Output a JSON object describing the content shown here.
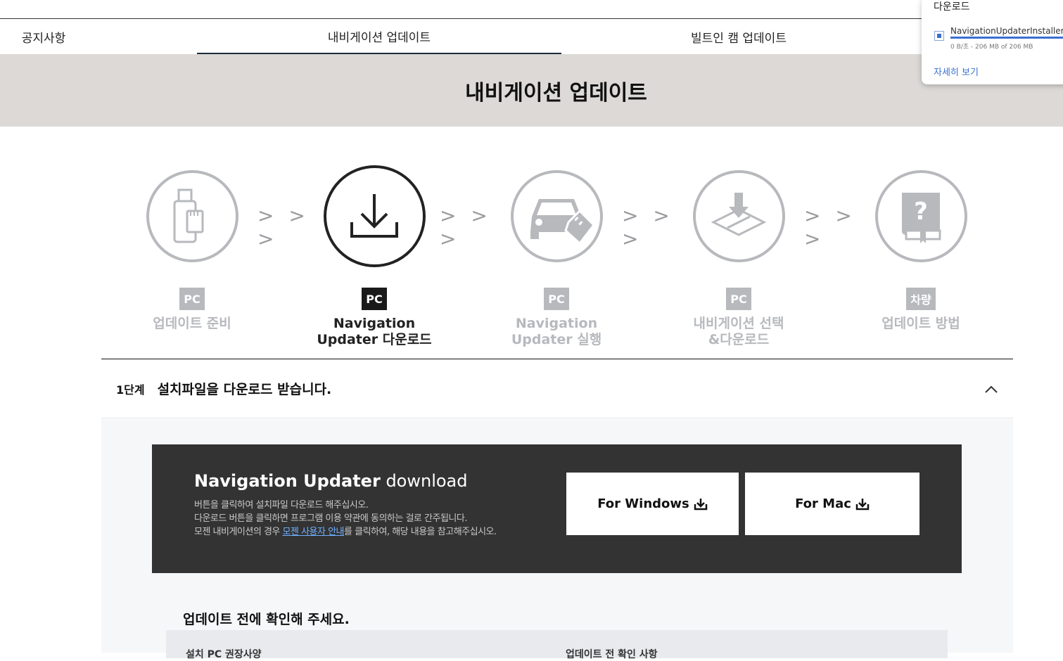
{
  "tabs": [
    {
      "label": "공지사항",
      "active": false
    },
    {
      "label": "내비게이션 업데이트",
      "active": true
    },
    {
      "label": "빌트인 캠 업데이트",
      "active": false
    }
  ],
  "banner": {
    "title": "내비게이션 업데이트"
  },
  "steps": [
    {
      "badge": "PC",
      "label": "업데이트 준비",
      "icon": "usb-sd-card-icon",
      "active": false
    },
    {
      "badge": "PC",
      "label": "Navigation\nUpdater 다운로드",
      "icon": "download-icon",
      "active": true
    },
    {
      "badge": "PC",
      "label": "Navigation\nUpdater 실행",
      "icon": "car-sd-card-icon",
      "active": false
    },
    {
      "badge": "PC",
      "label": "내비게이션 선택\n&다운로드",
      "icon": "map-download-icon",
      "active": false
    },
    {
      "badge": "차량",
      "label": "업데이트 방법",
      "icon": "help-book-icon",
      "active": false
    }
  ],
  "arrows": "> > >",
  "accordion": {
    "step": "1단계",
    "title": "설치파일을 다운로드 받습니다.",
    "expanded": true
  },
  "download_box": {
    "title_bold": "Navigation Updater",
    "title_light": "download",
    "desc_line1": "버튼을 클릭하여 설치파일 다운로드 해주십시오.",
    "desc_line2": "다운로드 버튼을 클릭하면 프로그램 이용 약관에 동의하는 걸로 간주됩니다.",
    "desc_line3_pre": "모젠 내비게이션의 경우",
    "desc_line3_link": "모젠 사용자 안내",
    "desc_line3_post": "를 클릭하여, 해당 내용을 참고해주십시오.",
    "windows_button": "For Windows",
    "mac_button": "For Mac"
  },
  "check_section": {
    "title": "업데이트 전에 확인해 주세요.",
    "col1": "설치 PC 권장사양",
    "col2": "업데이트 전 확인 사항"
  },
  "download_popup": {
    "title": "다운로드",
    "file_name": "NavigationUpdaterInstaller.exe",
    "file_status": "0 B/초 - 206 MB of 206 MB",
    "progress": 1.0,
    "more_link": "자세히 보기"
  },
  "colors": {
    "banner_bg": "#dcd9d6",
    "inactive_gray": "#b7b9bd",
    "dark_box": "#333334",
    "link_blue": "#3a6fd1"
  }
}
